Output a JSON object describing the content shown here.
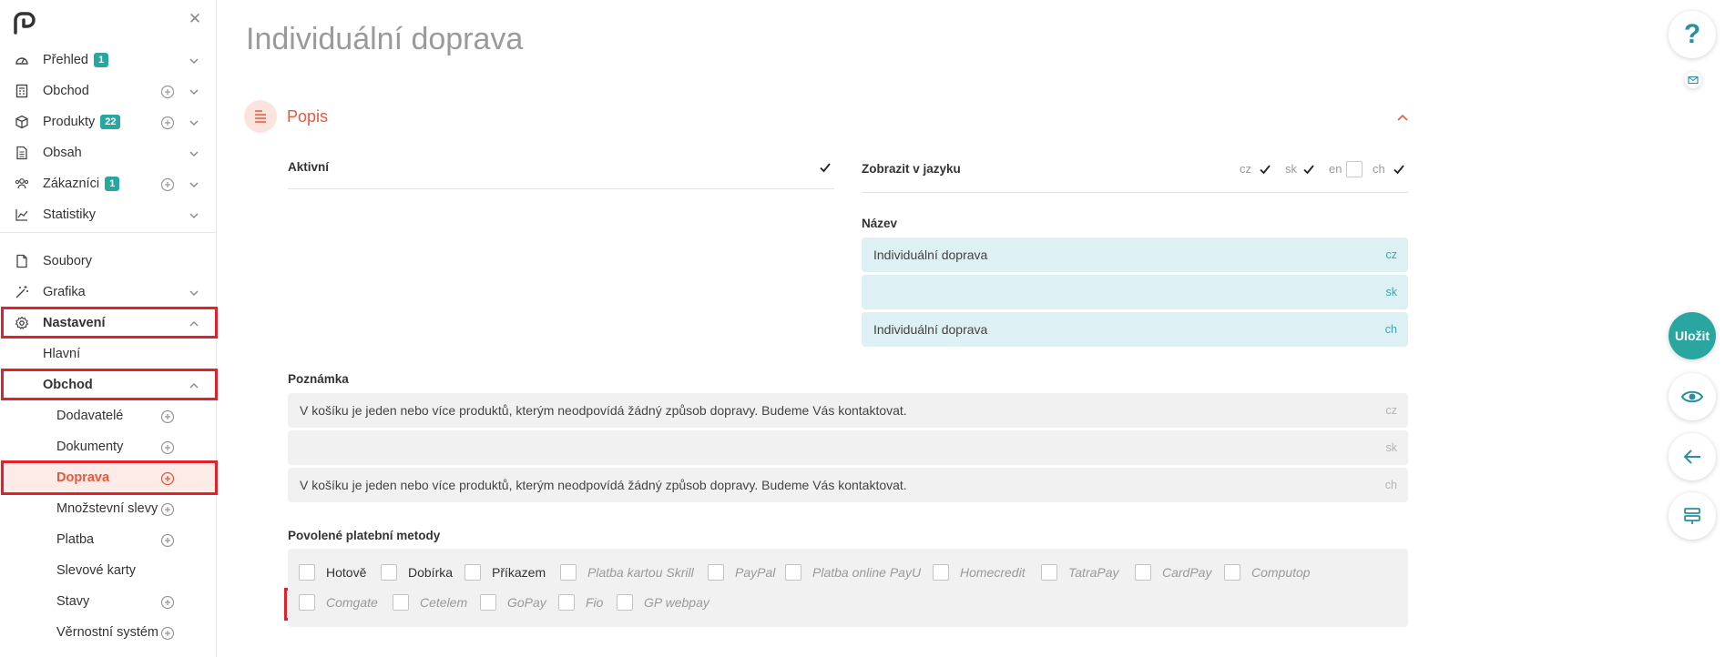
{
  "page": {
    "title": "Individuální doprava"
  },
  "sidebar": {
    "items": [
      {
        "label": "Přehled",
        "badge": "1",
        "icon": "dashboard-icon"
      },
      {
        "label": "Obchod",
        "icon": "cash-register-icon"
      },
      {
        "label": "Produkty",
        "badge": "22",
        "icon": "box-icon"
      },
      {
        "label": "Obsah",
        "icon": "document-icon"
      },
      {
        "label": "Zákazníci",
        "badge": "1",
        "icon": "users-icon"
      },
      {
        "label": "Statistiky",
        "icon": "chart-icon"
      },
      {
        "label": "Soubory",
        "icon": "file-icon"
      },
      {
        "label": "Grafika",
        "icon": "magic-wand-icon"
      },
      {
        "label": "Nastavení",
        "icon": "gear-icon"
      },
      {
        "label": "Hlavní"
      },
      {
        "label": "Obchod"
      },
      {
        "label": "Dodavatelé"
      },
      {
        "label": "Dokumenty"
      },
      {
        "label": "Doprava"
      },
      {
        "label": "Množstevní slevy"
      },
      {
        "label": "Platba"
      },
      {
        "label": "Slevové karty"
      },
      {
        "label": "Stavy"
      },
      {
        "label": "Věrnostní systém"
      }
    ]
  },
  "section": {
    "title": "Popis"
  },
  "form": {
    "active_label": "Aktivní",
    "active_checked": true,
    "show_lang_label": "Zobrazit v jazyku",
    "languages": [
      {
        "code": "cz",
        "checked": true
      },
      {
        "code": "sk",
        "checked": true
      },
      {
        "code": "en",
        "checked": false
      },
      {
        "code": "ch",
        "checked": true
      }
    ],
    "name_label": "Název",
    "name_values": [
      {
        "value": "Individuální doprava",
        "lang": "cz"
      },
      {
        "value": "",
        "lang": "sk"
      },
      {
        "value": "Individuální doprava",
        "lang": "ch"
      }
    ],
    "note_label": "Poznámka",
    "note_values": [
      {
        "value": "V košíku je jeden nebo více produktů, kterým neodpovídá žádný způsob dopravy. Budeme Vás kontaktovat.",
        "lang": "cz"
      },
      {
        "value": "",
        "lang": "sk"
      },
      {
        "value": "V košíku je jeden nebo více produktů, kterým neodpovídá žádný způsob dopravy. Budeme Vás kontaktovat.",
        "lang": "ch"
      }
    ],
    "payment_label": "Povolené platební metody",
    "payment_methods": [
      {
        "label": "Hotově",
        "enabled": true
      },
      {
        "label": "Dobírka",
        "enabled": true
      },
      {
        "label": "Příkazem",
        "enabled": true
      },
      {
        "label": "Platba kartou Skrill",
        "enabled": false
      },
      {
        "label": "PayPal",
        "enabled": false
      },
      {
        "label": "Platba online PayU",
        "enabled": false
      },
      {
        "label": "Homecredit",
        "enabled": false
      },
      {
        "label": "TatraPay",
        "enabled": false
      },
      {
        "label": "CardPay",
        "enabled": false
      },
      {
        "label": "Computop",
        "enabled": false
      },
      {
        "label": "Comgate",
        "enabled": false
      },
      {
        "label": "Cetelem",
        "enabled": false
      },
      {
        "label": "GoPay",
        "enabled": false
      },
      {
        "label": "Fio",
        "enabled": false
      },
      {
        "label": "GP webpay",
        "enabled": false
      }
    ]
  },
  "actions": {
    "help": "?",
    "save": "Uložit"
  },
  "colors": {
    "accent": "#e8583e",
    "teal": "#2aa6a1",
    "highlight": "#e0222d"
  }
}
